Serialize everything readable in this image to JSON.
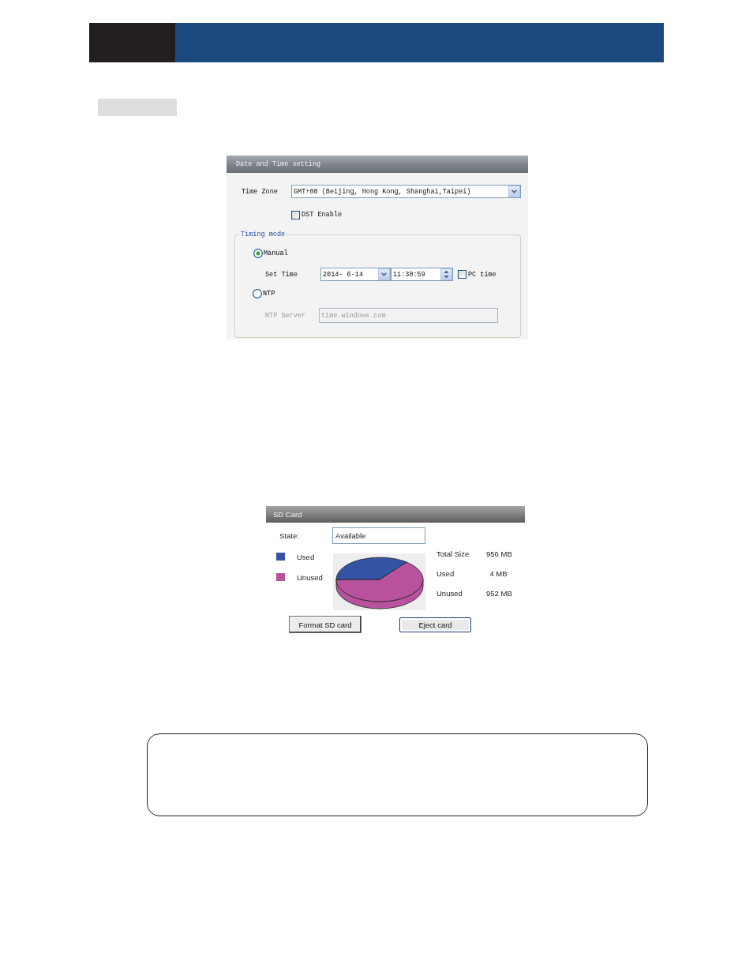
{
  "date_time_panel": {
    "title": "Date and Time setting",
    "time_zone": {
      "label": "Time Zone",
      "value": "GMT+08 (Beijing, Hong Kong, Shanghai,Taipei)"
    },
    "dst": {
      "label": "DST Enable",
      "checked": false
    },
    "timing_mode": {
      "legend": "Timing mode",
      "options": [
        {
          "label": "Manual",
          "selected": true
        },
        {
          "label": "NTP",
          "selected": false
        }
      ],
      "set_time": {
        "label": "Set Time",
        "date": "2014- 6-14",
        "time": "11:30:59",
        "pc_time": {
          "label": "PC time",
          "checked": false
        }
      },
      "ntp_server": {
        "label": "NTP Server",
        "value": "time.windows.com",
        "disabled": true
      }
    }
  },
  "sd_card_panel": {
    "title": "SD Card",
    "state": {
      "label": "State:",
      "value": "Available"
    },
    "legend": [
      {
        "label": "Used",
        "color": "#3353a5"
      },
      {
        "label": "Unused",
        "color": "#b8529e"
      }
    ],
    "stats": [
      {
        "label": "Total Size",
        "value": "956 MB"
      },
      {
        "label": "Used",
        "value": "4 MB"
      },
      {
        "label": "Unused",
        "value": "952 MB"
      }
    ],
    "buttons": [
      {
        "label": "Format SD card",
        "focused": false
      },
      {
        "label": "Eject card",
        "focused": true
      }
    ]
  }
}
